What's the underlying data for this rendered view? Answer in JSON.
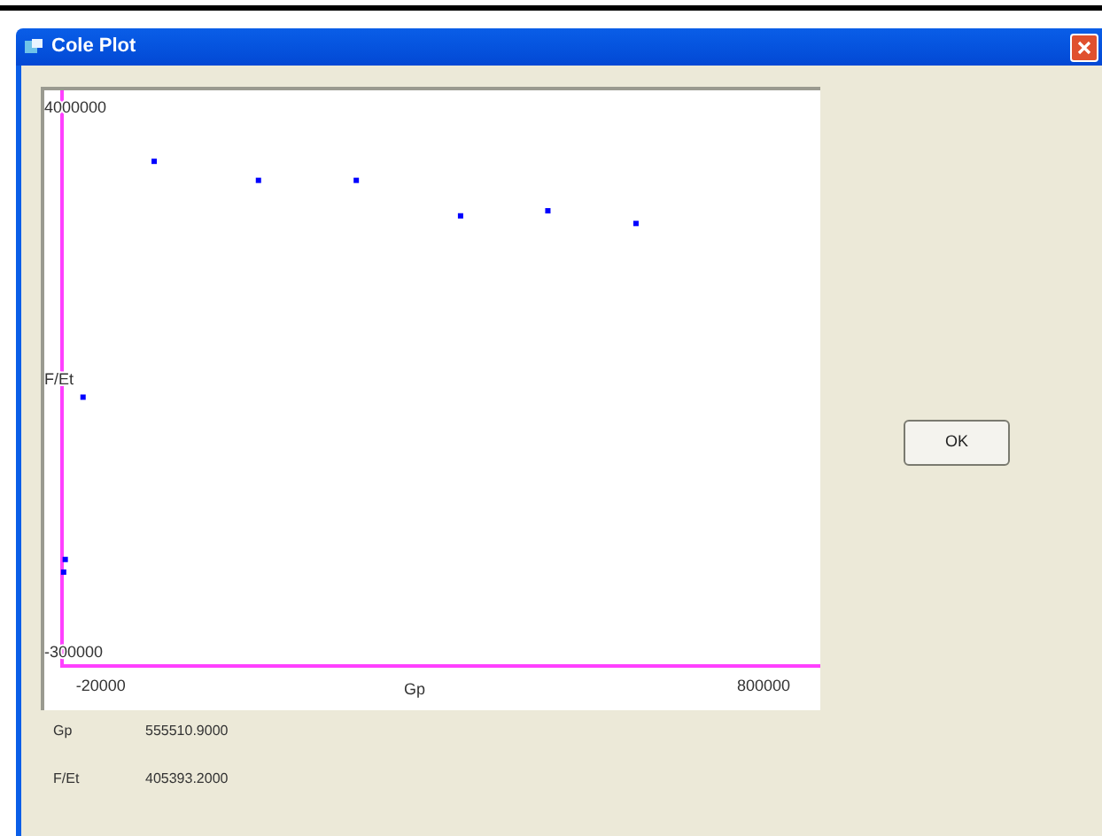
{
  "window": {
    "title": "Cole Plot"
  },
  "plot": {
    "chart_data": {
      "type": "scatter",
      "xlabel": "Gp",
      "ylabel": "F/Et",
      "xlim": [
        -68000,
        870000
      ],
      "ylim": [
        -400000,
        4140000
      ],
      "xticks": [
        -20000,
        800000
      ],
      "yticks": [
        -300000,
        4000000
      ],
      "x": [
        46000,
        175000,
        296000,
        425000,
        533000,
        642000,
        -42000,
        -64000,
        -66000
      ],
      "series": [
        {
          "color": "#0000ff",
          "values": [
            3580000,
            3430000,
            3430000,
            3150000,
            3190000,
            3090000,
            1720000,
            440000,
            340000
          ]
        }
      ]
    }
  },
  "readouts": [
    {
      "label": "Gp",
      "value": "555510.9000"
    },
    {
      "label": "F/Et",
      "value": "405393.2000"
    }
  ],
  "buttons": [
    "OK"
  ]
}
